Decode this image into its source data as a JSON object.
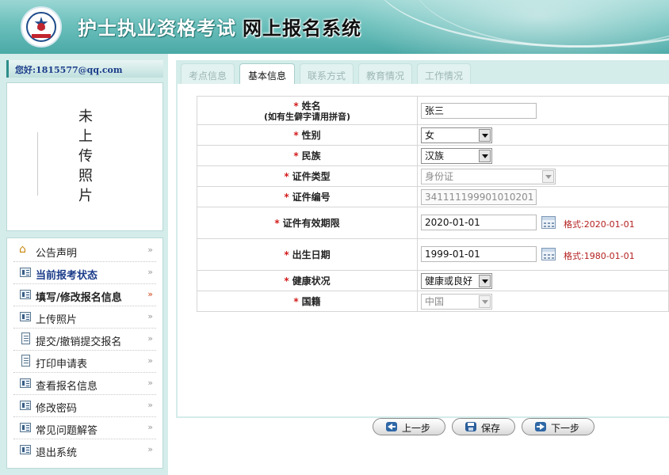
{
  "header": {
    "title_part1": "护士执业资格考试",
    "title_part2": "网上报名系统"
  },
  "user": {
    "greeting": "您好:1815577@qq.com"
  },
  "photo": {
    "status_text": "未上传照片"
  },
  "menu": [
    {
      "label": "公告声明",
      "icon": "home-icon",
      "style": "normal",
      "active": false
    },
    {
      "label": "当前报考状态",
      "icon": "list-icon",
      "style": "blue-bold",
      "active": false
    },
    {
      "label": "填写/修改报名信息",
      "icon": "list-icon",
      "style": "bold",
      "active": true
    },
    {
      "label": "上传照片",
      "icon": "list-icon",
      "style": "normal",
      "active": false
    },
    {
      "label": "提交/撤销提交报名",
      "icon": "doc-icon",
      "style": "normal",
      "active": false
    },
    {
      "label": "打印申请表",
      "icon": "doc-icon",
      "style": "normal",
      "active": false
    },
    {
      "label": "查看报名信息",
      "icon": "list-icon",
      "style": "normal",
      "active": false
    },
    {
      "label": "修改密码",
      "icon": "list-icon",
      "style": "normal",
      "active": false
    },
    {
      "label": "常见问题解答",
      "icon": "list-icon",
      "style": "normal",
      "active": false
    },
    {
      "label": "退出系统",
      "icon": "list-icon",
      "style": "normal",
      "active": false
    }
  ],
  "tabs": [
    {
      "label": "考点信息",
      "active": false
    },
    {
      "label": "基本信息",
      "active": true
    },
    {
      "label": "联系方式",
      "active": false
    },
    {
      "label": "教育情况",
      "active": false
    },
    {
      "label": "工作情况",
      "active": false
    }
  ],
  "form": {
    "required_mark": "*",
    "name": {
      "label": "姓名",
      "hint": "(如有生僻字请用拼音)",
      "value": "张三"
    },
    "gender": {
      "label": "性别",
      "value": "女"
    },
    "ethnicity": {
      "label": "民族",
      "value": "汉族"
    },
    "id_type": {
      "label": "证件类型",
      "value": "身份证"
    },
    "id_number": {
      "label": "证件编号",
      "value": "341111199901010201"
    },
    "id_validity": {
      "label": "证件有效期限",
      "value": "2020-01-01",
      "format": "格式:2020-01-01"
    },
    "birth_date": {
      "label": "出生日期",
      "value": "1999-01-01",
      "format": "格式:1980-01-01"
    },
    "health": {
      "label": "健康状况",
      "value": "健康或良好"
    },
    "nationality": {
      "label": "国籍",
      "value": "中国"
    }
  },
  "buttons": {
    "prev": "上一步",
    "save": "保存",
    "next": "下一步"
  },
  "colors": {
    "header_teal": "#6cc0bc",
    "panel_bg": "#d4ecea",
    "required_red": "#d21b1b",
    "format_red": "#b42020",
    "greeting_blue": "#1b3c8a"
  }
}
